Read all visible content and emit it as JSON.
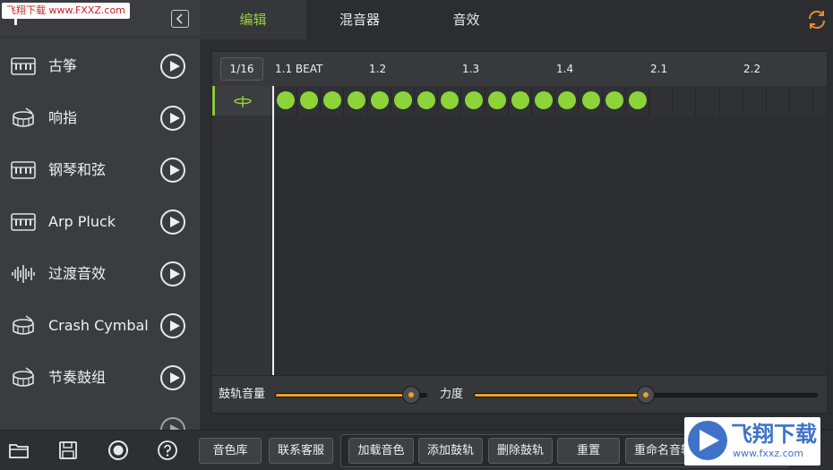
{
  "watermark_top": "飞翔下载 www.FXXZ.com",
  "sidebar": {
    "items": [
      {
        "label": "古筝",
        "icon": "keyboard-icon"
      },
      {
        "label": "响指",
        "icon": "drum-icon"
      },
      {
        "label": "钢琴和弦",
        "icon": "keyboard-icon"
      },
      {
        "label": "Arp Pluck",
        "icon": "keyboard-icon"
      },
      {
        "label": "过渡音效",
        "icon": "waveform-icon"
      },
      {
        "label": "Crash Cymbal",
        "icon": "drum-icon"
      },
      {
        "label": "节奏鼓组",
        "icon": "drum-icon"
      }
    ]
  },
  "tabs": [
    {
      "label": "编辑",
      "active": true
    },
    {
      "label": "混音器",
      "active": false
    },
    {
      "label": "音效",
      "active": false
    }
  ],
  "editor": {
    "grid_resolution": "1/16",
    "beat_markers": [
      "1.1 BEAT",
      "1.2",
      "1.3",
      "1.4",
      "2.1",
      "2.2"
    ],
    "track_icon": "cymbal-icon",
    "total_steps": 24,
    "active_steps": 16,
    "step_color": "#8cd43a"
  },
  "sliders": {
    "track_volume": {
      "label": "鼓轨音量",
      "value": 0.9
    },
    "velocity": {
      "label": "力度",
      "value": 0.5
    }
  },
  "toolbar": {
    "icons": [
      "folder-icon",
      "save-icon",
      "record-icon",
      "help-icon"
    ],
    "sound_library": "音色库",
    "contact_support": "联系客服",
    "load_sound": "加载音色",
    "add_track": "添加鼓轨",
    "delete_track": "删除鼓轨",
    "reset": "重置",
    "rename_track": "重命名音轨"
  },
  "watermark_bottom": {
    "text": "飞翔下载",
    "url": "www.fxxz.com"
  },
  "colors": {
    "accent_green": "#9ad13b",
    "accent_orange": "#e8a323",
    "sync_orange": "#e8892b"
  }
}
